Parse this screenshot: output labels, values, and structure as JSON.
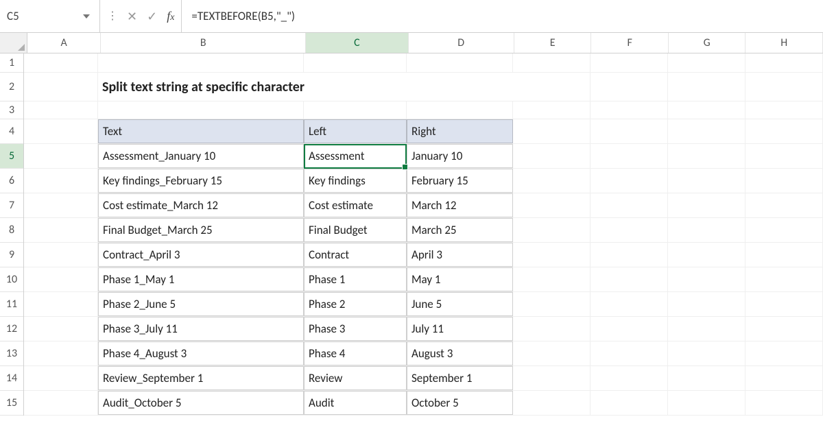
{
  "namebox": {
    "value": "C5"
  },
  "formula": {
    "value": "=TEXTBEFORE(B5,\"_\")"
  },
  "columns": [
    "A",
    "B",
    "C",
    "D",
    "E",
    "F",
    "G",
    "H"
  ],
  "active_col": "C",
  "rows": [
    "1",
    "2",
    "3",
    "4",
    "5",
    "6",
    "7",
    "8",
    "9",
    "10",
    "11",
    "12",
    "13",
    "14",
    "15"
  ],
  "active_row": "5",
  "title": "Split text string at specific character",
  "table": {
    "headers": {
      "text": "Text",
      "left": "Left",
      "right": "Right"
    },
    "rows": [
      {
        "text": "Assessment_January 10",
        "left": "Assessment",
        "right": "January 10"
      },
      {
        "text": "Key findings_February 15",
        "left": "Key findings",
        "right": "February 15"
      },
      {
        "text": "Cost estimate_March 12",
        "left": "Cost estimate",
        "right": "March 12"
      },
      {
        "text": "Final Budget_March 25",
        "left": "Final Budget",
        "right": "March 25"
      },
      {
        "text": "Contract_April 3",
        "left": "Contract",
        "right": "April 3"
      },
      {
        "text": "Phase 1_May 1",
        "left": "Phase 1",
        "right": "May 1"
      },
      {
        "text": "Phase 2_June 5",
        "left": "Phase 2",
        "right": "June 5"
      },
      {
        "text": "Phase 3_July 11",
        "left": "Phase 3",
        "right": "July 11"
      },
      {
        "text": "Phase 4_August 3",
        "left": "Phase 4",
        "right": "August 3"
      },
      {
        "text": "Review_September 1",
        "left": "Review",
        "right": "September 1"
      },
      {
        "text": "Audit_October 5",
        "left": "Audit",
        "right": "October 5"
      }
    ]
  }
}
